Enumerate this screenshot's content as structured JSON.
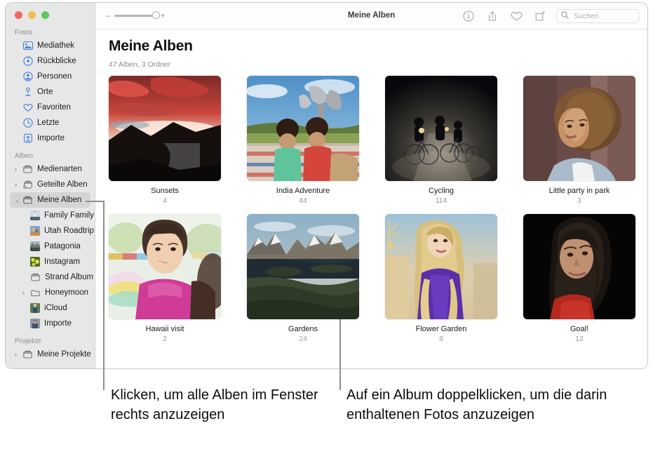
{
  "window": {
    "title": "Meine Alben",
    "traffic_lights": [
      "close",
      "minimize",
      "zoom"
    ]
  },
  "toolbar": {
    "zoom_minus": "–",
    "zoom_plus": "+",
    "buttons": [
      {
        "name": "info-icon",
        "label": "Info"
      },
      {
        "name": "share-icon",
        "label": "Teilen"
      },
      {
        "name": "favorite-heart-icon",
        "label": "Favorit"
      },
      {
        "name": "rotate-icon",
        "label": "Drehen"
      }
    ],
    "search": {
      "placeholder": "Suchen",
      "value": "",
      "icon": "search-icon"
    }
  },
  "sidebar": {
    "sections": [
      {
        "label": "Fotos",
        "items": [
          {
            "label": "Mediathek",
            "icon": "library-icon"
          },
          {
            "label": "Rückblicke",
            "icon": "memories-icon"
          },
          {
            "label": "Personen",
            "icon": "people-icon"
          },
          {
            "label": "Orte",
            "icon": "places-pin-icon"
          },
          {
            "label": "Favoriten",
            "icon": "heart-icon"
          },
          {
            "label": "Letzte",
            "icon": "clock-icon"
          },
          {
            "label": "Importe",
            "icon": "import-icon"
          }
        ]
      },
      {
        "label": "Alben",
        "items": [
          {
            "label": "Medienarten",
            "icon": "folder-icon",
            "twisty": "›",
            "indent": 0
          },
          {
            "label": "Geteilte Alben",
            "icon": "shared-album-icon",
            "twisty": "›",
            "indent": 0
          },
          {
            "label": "Meine Alben",
            "icon": "album-icon",
            "twisty": "⌄",
            "indent": 0,
            "selected": true
          },
          {
            "label": "Family Family…",
            "icon": "photo-thumb-boat",
            "indent": 1
          },
          {
            "label": "Utah Roadtrip",
            "icon": "photo-thumb-utah",
            "indent": 1
          },
          {
            "label": "Patagonia",
            "icon": "photo-thumb-patagonia",
            "indent": 1
          },
          {
            "label": "Instagram",
            "icon": "photo-thumb-instagram",
            "indent": 1
          },
          {
            "label": "Strand Album",
            "icon": "album-icon",
            "indent": 1
          },
          {
            "label": "Honeymoon",
            "icon": "folder-icon",
            "twisty": "›",
            "indent": 1
          },
          {
            "label": "iCloud",
            "icon": "photo-thumb-icloud",
            "indent": 1
          },
          {
            "label": "Importe",
            "icon": "photo-thumb-importe",
            "indent": 1
          }
        ]
      },
      {
        "label": "Projekte",
        "items": [
          {
            "label": "Meine Projekte",
            "icon": "folder-icon",
            "twisty": "›",
            "indent": 0
          }
        ]
      }
    ]
  },
  "main": {
    "title": "Meine Alben",
    "subtitle": "47 Alben, 3 Ordner",
    "albums": [
      {
        "name": "Sunsets",
        "count": "4",
        "thumb": "sunset-mountain-lake"
      },
      {
        "name": "India Adventure",
        "count": "44",
        "thumb": "two-boys-picnic"
      },
      {
        "name": "Cycling",
        "count": "114",
        "thumb": "night-cyclists"
      },
      {
        "name": "Little party in park",
        "count": "3",
        "thumb": "woman-curly-hair"
      },
      {
        "name": "Hawaii visit",
        "count": "2",
        "thumb": "girl-pink-shirt"
      },
      {
        "name": "Gardens",
        "count": "24",
        "thumb": "patagonia-mountains"
      },
      {
        "name": "Flower Garden",
        "count": "8",
        "thumb": "woman-purple-shirt"
      },
      {
        "name": "Goal!",
        "count": "12",
        "thumb": "woman-dark-background"
      }
    ]
  },
  "callouts": [
    {
      "name": "callout-left",
      "text": "Klicken, um alle Alben im Fenster rechts anzuzeigen"
    },
    {
      "name": "callout-right",
      "text": "Auf ein Album doppelklicken, um die darin enthaltenen Fotos anzuzeigen"
    }
  ],
  "colors": {
    "accent_blue": "#3f7fe0",
    "sidebar_bg": "#e7e7e7",
    "selection": "#d4d4d4",
    "text": "#1c1c1c",
    "muted": "#8b8b8b"
  }
}
